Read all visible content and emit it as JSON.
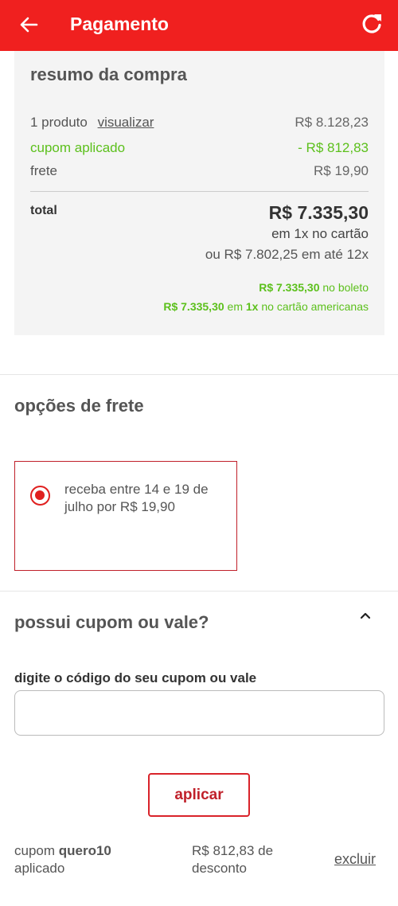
{
  "header": {
    "title": "Pagamento",
    "back_icon": "arrow-left-icon",
    "refresh_icon": "refresh-icon",
    "brand_color": "#f0201f"
  },
  "summary": {
    "heading": "resumo da compra",
    "products": {
      "label": "1 produto",
      "link": "visualizar",
      "value": "R$ 8.128,23"
    },
    "coupon": {
      "label": "cupom aplicado",
      "value": "- R$ 812,83"
    },
    "shipping": {
      "label": "frete",
      "value": "R$ 19,90"
    },
    "total": {
      "label": "total",
      "value": "R$ 7.335,30",
      "condition": "em 1x no cartão",
      "installments": "ou R$ 7.802,25 em até 12x"
    },
    "boleto": {
      "amount": "R$ 7.335,30",
      "text": " no boleto"
    },
    "americanas_card": {
      "amount": "R$ 7.335,30",
      "mid": " em ",
      "times": "1x",
      "text": " no cartão americanas"
    },
    "highlight_color": "#5cc01c"
  },
  "shipping_options": {
    "title": "opções de frete",
    "option": {
      "text": "receba entre 14 e 19 de julho por R$ 19,90",
      "selected": true
    }
  },
  "coupon_section": {
    "title": "possui cupom ou vale?",
    "toggle_icon": "chevron-up-icon",
    "input_label": "digite o código do seu cupom ou vale",
    "input_value": "",
    "input_placeholder": "",
    "apply_label": "aplicar",
    "applied_prefix": "cupom ",
    "applied_code": "quero10",
    "applied_suffix": "aplicado",
    "discount_text": "R$ 812,83 de desconto",
    "remove_label": "excluir",
    "accent_color": "#d9232a"
  }
}
